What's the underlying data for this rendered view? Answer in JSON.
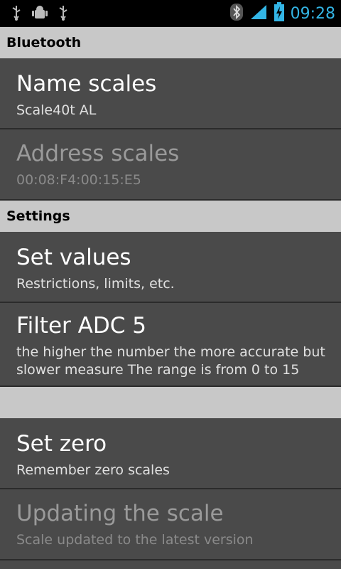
{
  "status_bar": {
    "time": "09:28",
    "icons": [
      "usb-icon",
      "android-debug-icon",
      "usb-icon",
      "bluetooth-icon",
      "signal-icon",
      "battery-charging-icon"
    ],
    "accent_color": "#33b5e5"
  },
  "sections": [
    {
      "header": "Bluetooth",
      "items": [
        {
          "title": "Name scales",
          "summary": "Scale40t AL",
          "enabled": true
        },
        {
          "title": "Address scales",
          "summary": "00:08:F4:00:15:E5",
          "enabled": false
        }
      ]
    },
    {
      "header": "Settings",
      "items": [
        {
          "title": "Set values",
          "summary": "Restrictions, limits, etc.",
          "enabled": true
        },
        {
          "title": "Filter ADC 5",
          "summary_line1": "the higher the number the more accurate but",
          "summary_line2": "slower measure The range is from 0 to 15",
          "enabled": true
        }
      ]
    },
    {
      "header": "",
      "items": [
        {
          "title": "Set zero",
          "summary": "Remember zero scales",
          "enabled": true
        },
        {
          "title": "Updating the scale",
          "summary": "Scale updated to the latest version",
          "enabled": false
        }
      ]
    }
  ]
}
